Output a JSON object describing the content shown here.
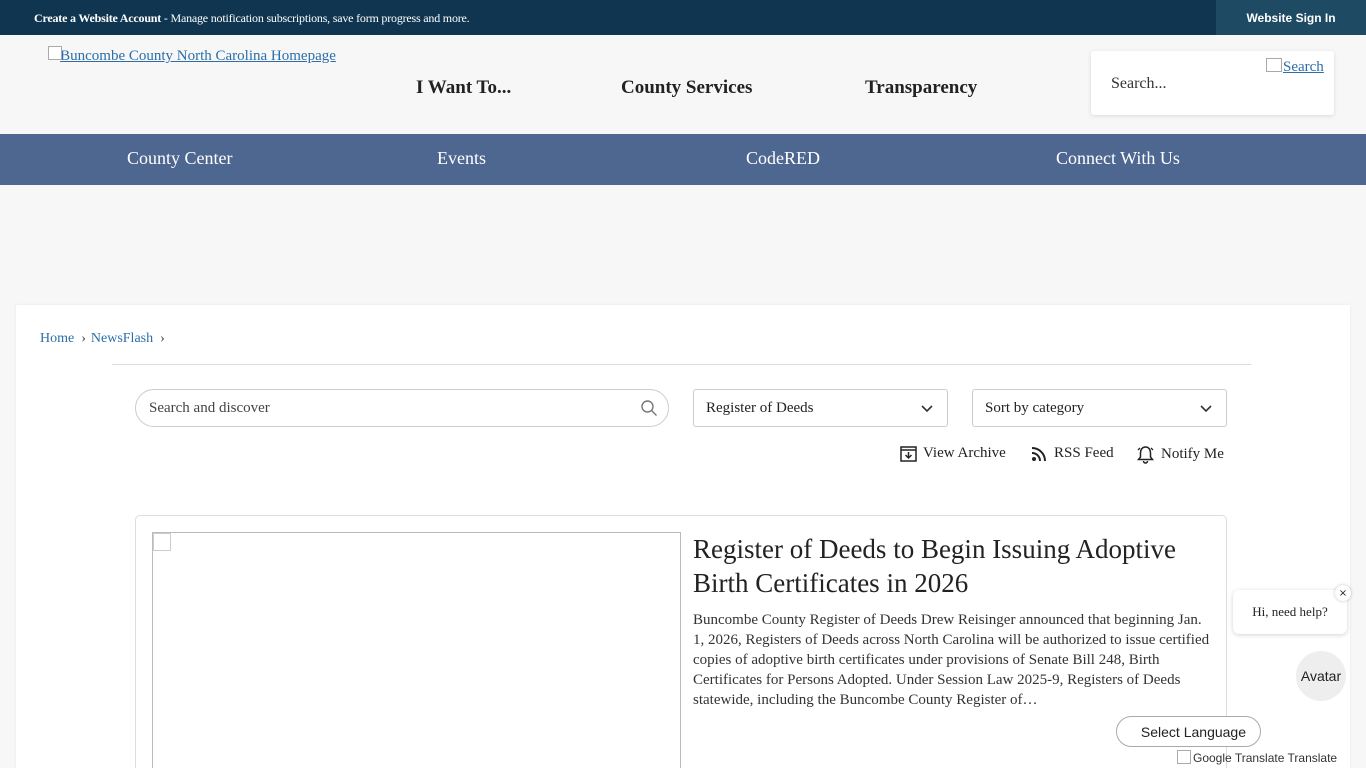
{
  "topbar": {
    "account_link": "Create a Website Account",
    "account_desc": " - Manage notification subscriptions, save form progress and more.",
    "signin": "Website Sign In"
  },
  "header": {
    "logo_alt": "Buncombe County North Carolina Homepage",
    "nav": [
      "I Want To...",
      "County Services",
      "Transparency"
    ],
    "search_placeholder": "Search...",
    "search_button": "Search"
  },
  "subnav": [
    "County Center",
    "Events",
    "CodeRED",
    "Connect With Us"
  ],
  "breadcrumb": [
    "Home",
    "NewsFlash"
  ],
  "filters": {
    "search_placeholder": "Search and discover",
    "category": "Register of Deeds",
    "sort": "Sort by category"
  },
  "tools": {
    "archive": "View Archive",
    "rss": "RSS Feed",
    "notify": "Notify Me"
  },
  "article": {
    "title": "Register of Deeds to Begin Issuing Adoptive Birth Certificates in 2026",
    "summary": "Buncombe County Register of Deeds Drew Reisinger announced that beginning Jan. 1, 2026, Registers of Deeds across North Carolina will be authorized to issue certified copies of adoptive birth certificates under provisions of Senate Bill 248, Birth Certificates for Persons Adopted. Under Session Law 2025-9, Registers of Deeds statewide, including the Buncombe County Register of…"
  },
  "chat": {
    "bubble": "Hi, need help?",
    "close": "×",
    "avatar": "Avatar"
  },
  "translate": {
    "select": "Select Language",
    "google": "Google Translate",
    "label": "Translate"
  }
}
